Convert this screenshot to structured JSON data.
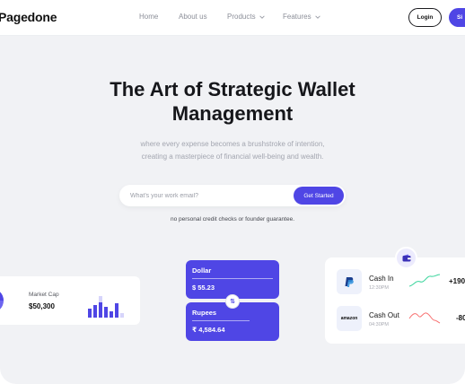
{
  "brand": {
    "name": "Pagedone",
    "accent": "#4f46e5"
  },
  "nav": {
    "links": [
      {
        "label": "Home"
      },
      {
        "label": "About us"
      },
      {
        "label": "Products"
      },
      {
        "label": "Features"
      }
    ],
    "login_label": "Login",
    "signup_label": "Si"
  },
  "hero": {
    "title_line1": "The Art of Strategic Wallet",
    "title_line2": "Management",
    "subtitle_line1": "where every expense becomes a brushstroke of intention,",
    "subtitle_line2": "creating a masterpiece of financial well-being and wealth.",
    "email_placeholder": "What's your work email?",
    "cta_label": "Get Started",
    "note": "no personal credit checks or founder guarantee."
  },
  "market": {
    "label": "Market Cap",
    "value": "$50,300"
  },
  "currency": {
    "dollar": {
      "name": "Dollar",
      "value": "$ 55.23"
    },
    "rupees": {
      "name": "Rupees",
      "value": "₹ 4,584.64"
    }
  },
  "cash": {
    "rows": [
      {
        "title": "Cash In",
        "time": "12:30PM",
        "amount": "+190",
        "icon": "paypal-icon",
        "trend": "up",
        "color": "#34d399"
      },
      {
        "title": "Cash Out",
        "time": "04:30PM",
        "amount": "-80",
        "icon": "amazon-icon",
        "trend": "down",
        "color": "#f87171"
      }
    ]
  },
  "icons": {
    "amazon_text": "amazon"
  }
}
